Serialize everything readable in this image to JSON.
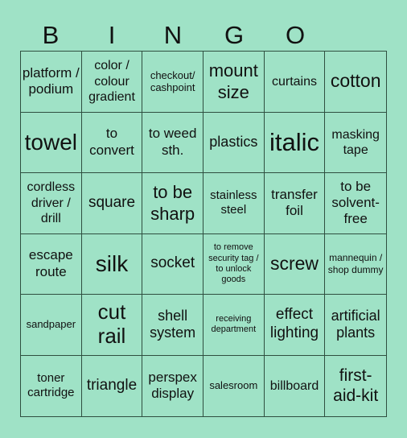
{
  "header": [
    "B",
    "I",
    "N",
    "G",
    "O",
    ""
  ],
  "cells": [
    "platform / podium",
    "color / colour gradient",
    "checkout/ cashpoint",
    "mount size",
    "curtains",
    "cotton",
    "towel",
    "to convert",
    "to weed sth.",
    "plastics",
    "italic",
    "masking tape",
    "cordless driver / drill",
    "square",
    "to be sharp",
    "stainless steel",
    "transfer foil",
    "to be solvent-free",
    "escape route",
    "silk",
    "socket",
    "to remove security tag / to unlock goods",
    "screw",
    "mannequin / shop dummy",
    "sandpaper",
    "cut rail",
    "shell system",
    "receiving department",
    "effect lighting",
    "artificial plants",
    "toner cartridge",
    "triangle",
    "perspex display",
    "salesroom",
    "billboard",
    "first-aid-kit"
  ],
  "colors": {
    "background": "#9fe2c6",
    "grid_line": "#2f4f40",
    "text": "#111111"
  }
}
